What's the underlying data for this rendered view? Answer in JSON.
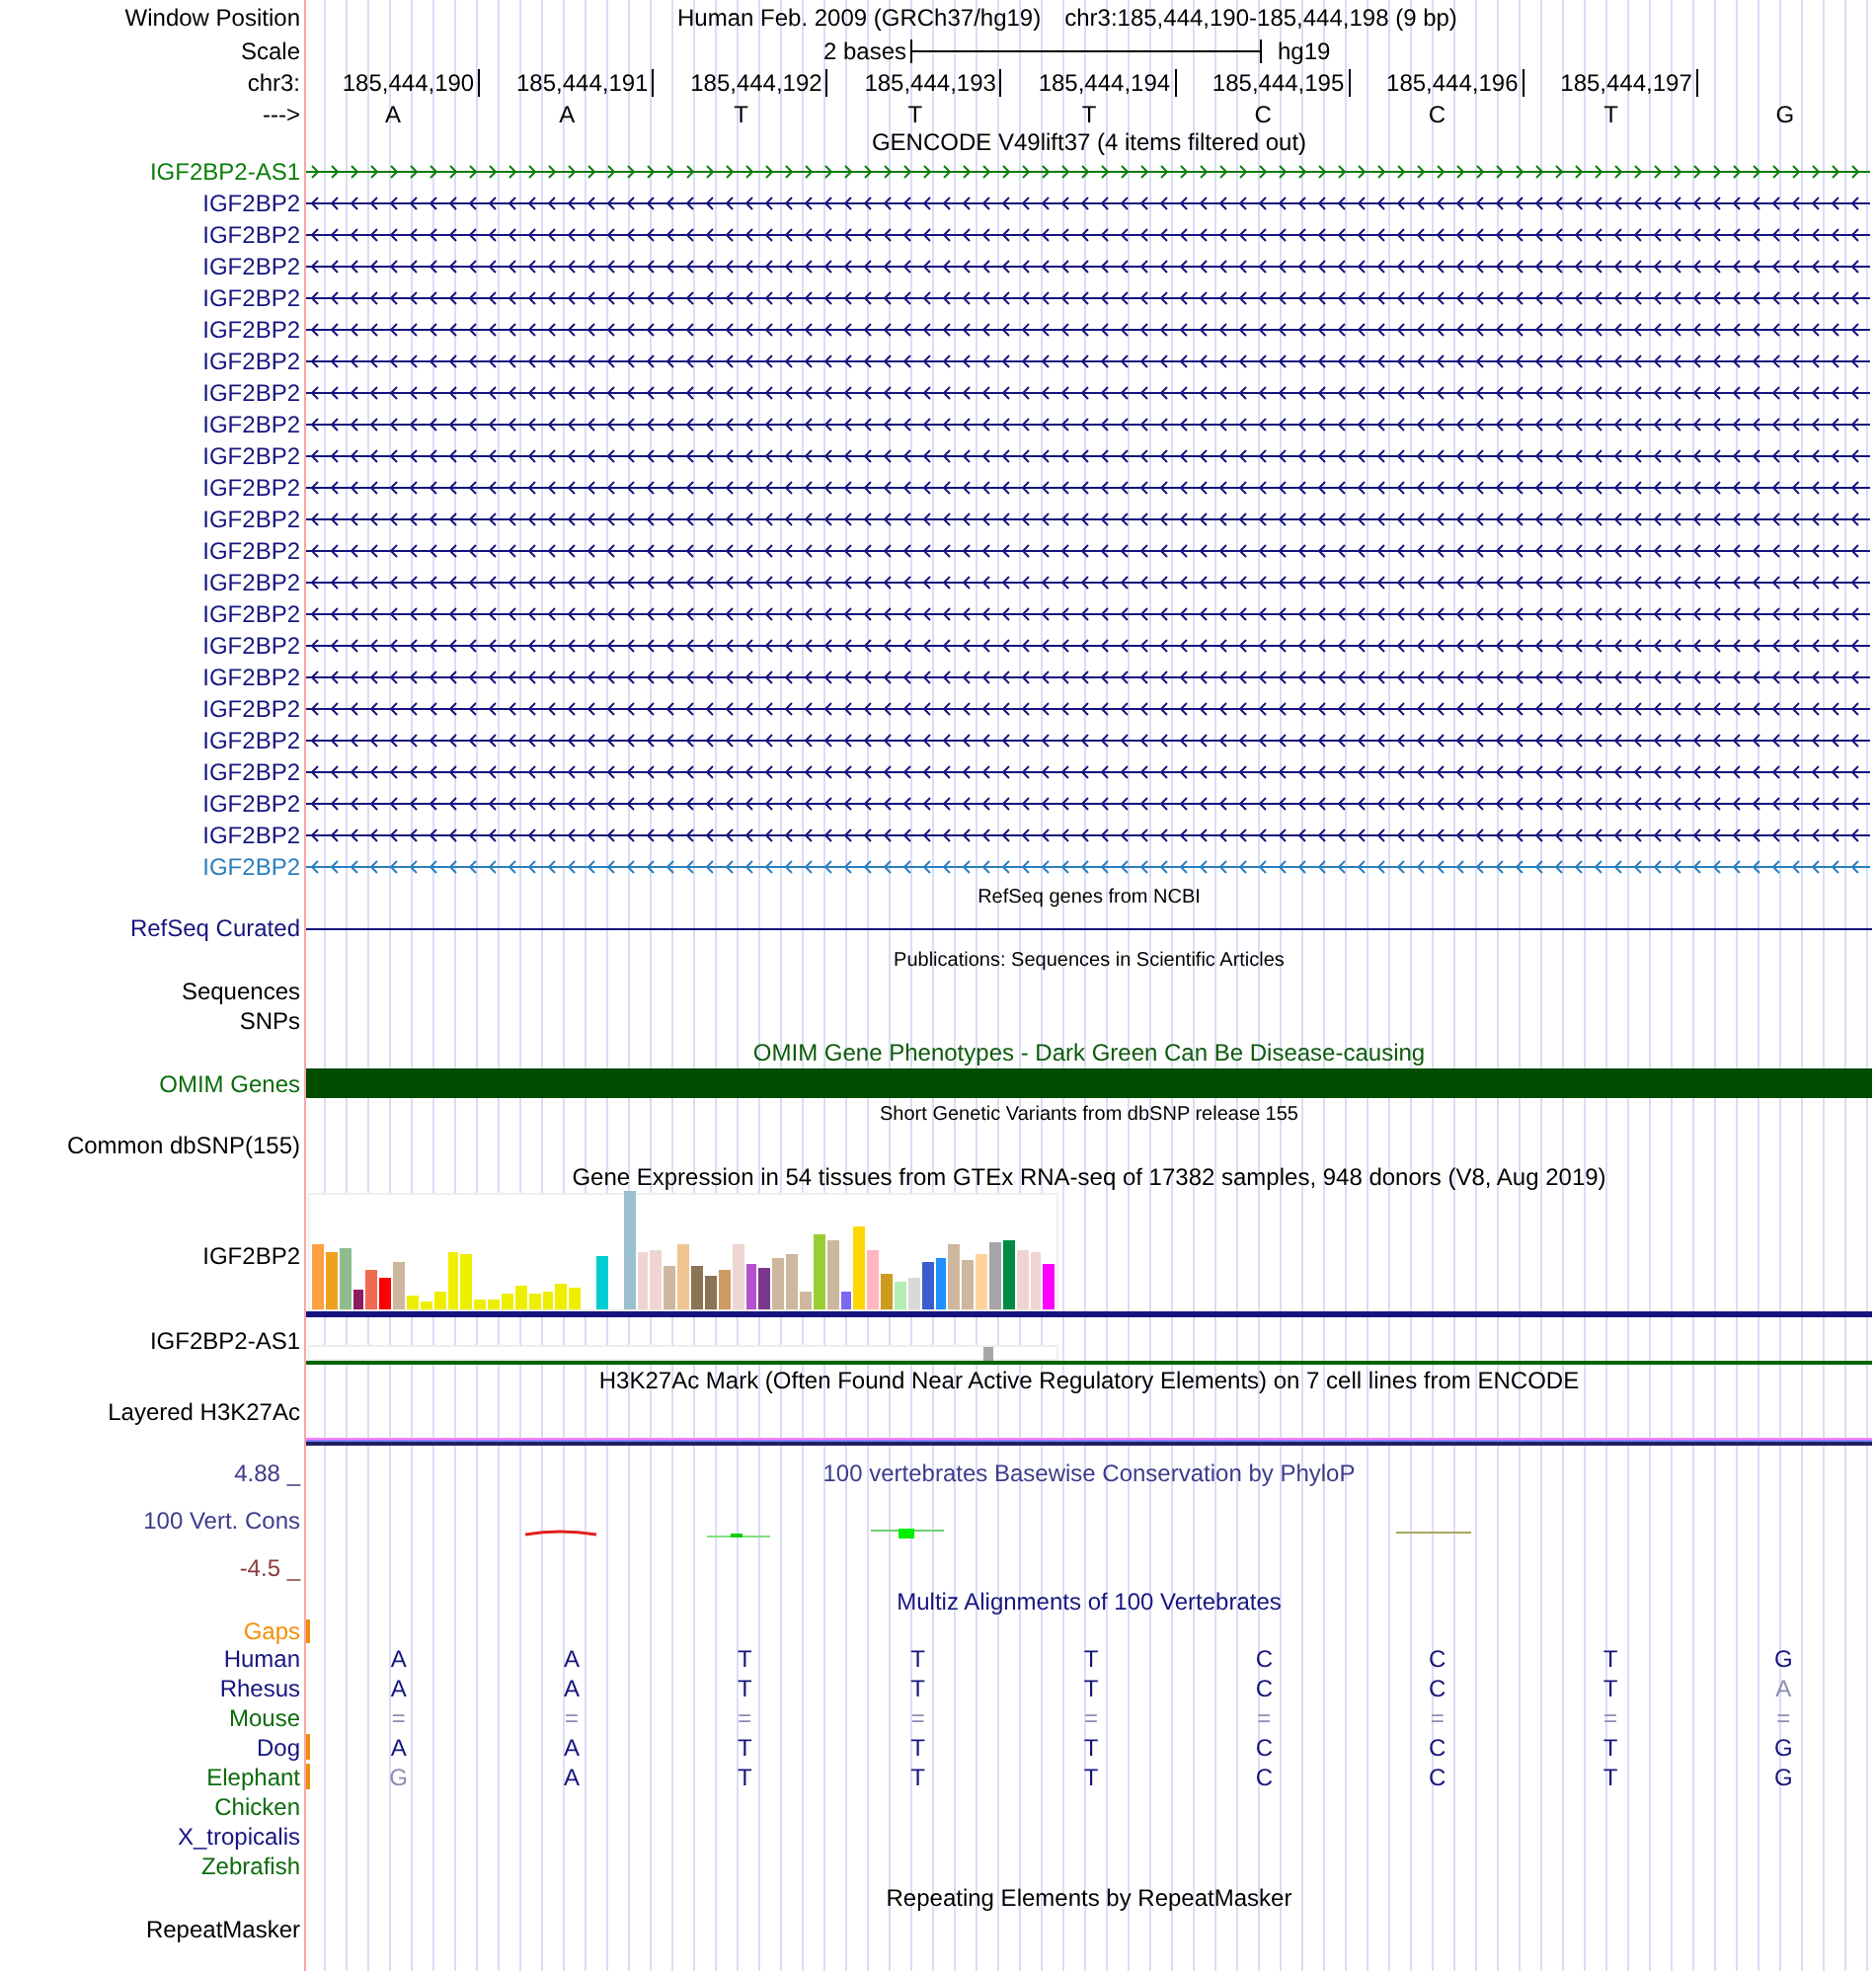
{
  "header": {
    "window_position_label": "Window Position",
    "assembly_title": "Human Feb. 2009 (GRCh37/hg19)",
    "position": "chr3:185,444,190-185,444,198 (9 bp)",
    "scale_label": "Scale",
    "scale_text": "2 bases",
    "scale_assembly": "hg19",
    "chrom_label": "chr3:",
    "positions": [
      "185,444,190",
      "185,444,191",
      "185,444,192",
      "185,444,193",
      "185,444,194",
      "185,444,195",
      "185,444,196",
      "185,444,197"
    ],
    "strand_label": "--->",
    "bases": [
      "A",
      "A",
      "T",
      "T",
      "T",
      "C",
      "C",
      "T",
      "G"
    ]
  },
  "gencode": {
    "title": "GENCODE V49lift37 (4 items filtered out)",
    "genes": [
      {
        "name": "IGF2BP2-AS1",
        "color": "#0b7d0b",
        "kind": "forward"
      },
      {
        "name": "IGF2BP2",
        "color": "#15157f",
        "kind": "reverse"
      },
      {
        "name": "IGF2BP2",
        "color": "#15157f",
        "kind": "reverse"
      },
      {
        "name": "IGF2BP2",
        "color": "#15157f",
        "kind": "reverse"
      },
      {
        "name": "IGF2BP2",
        "color": "#15157f",
        "kind": "reverse"
      },
      {
        "name": "IGF2BP2",
        "color": "#15157f",
        "kind": "reverse"
      },
      {
        "name": "IGF2BP2",
        "color": "#15157f",
        "kind": "reverse"
      },
      {
        "name": "IGF2BP2",
        "color": "#15157f",
        "kind": "reverse"
      },
      {
        "name": "IGF2BP2",
        "color": "#15157f",
        "kind": "reverse"
      },
      {
        "name": "IGF2BP2",
        "color": "#15157f",
        "kind": "reverse"
      },
      {
        "name": "IGF2BP2",
        "color": "#15157f",
        "kind": "reverse"
      },
      {
        "name": "IGF2BP2",
        "color": "#15157f",
        "kind": "reverse"
      },
      {
        "name": "IGF2BP2",
        "color": "#15157f",
        "kind": "reverse"
      },
      {
        "name": "IGF2BP2",
        "color": "#15157f",
        "kind": "reverse"
      },
      {
        "name": "IGF2BP2",
        "color": "#15157f",
        "kind": "reverse"
      },
      {
        "name": "IGF2BP2",
        "color": "#15157f",
        "kind": "reverse"
      },
      {
        "name": "IGF2BP2",
        "color": "#15157f",
        "kind": "reverse"
      },
      {
        "name": "IGF2BP2",
        "color": "#15157f",
        "kind": "reverse"
      },
      {
        "name": "IGF2BP2",
        "color": "#15157f",
        "kind": "reverse"
      },
      {
        "name": "IGF2BP2",
        "color": "#15157f",
        "kind": "reverse"
      },
      {
        "name": "IGF2BP2",
        "color": "#15157f",
        "kind": "reverse"
      },
      {
        "name": "IGF2BP2",
        "color": "#15157f",
        "kind": "reverse"
      },
      {
        "name": "IGF2BP2",
        "color": "#2a7fbf",
        "kind": "reverse"
      }
    ]
  },
  "refseq": {
    "title": "RefSeq genes from NCBI",
    "label": "RefSeq Curated"
  },
  "publications": {
    "title": "Publications: Sequences in Scientific Articles",
    "labels": [
      "Sequences",
      "SNPs"
    ]
  },
  "omim": {
    "title": "OMIM Gene Phenotypes - Dark Green Can Be Disease-causing",
    "label": "OMIM Genes"
  },
  "dbsnp": {
    "title": "Short Genetic Variants from dbSNP release 155",
    "label": "Common dbSNP(155)"
  },
  "gtex": {
    "title": "Gene Expression in 54 tissues from GTEx RNA-seq of 17382 samples, 948 donors (V8, Aug 2019)",
    "genes": [
      "IGF2BP2",
      "IGF2BP2-AS1"
    ]
  },
  "h3k27ac": {
    "title": "H3K27Ac Mark (Often Found Near Active Regulatory Elements) on 7 cell lines from ENCODE",
    "label": "Layered H3K27Ac"
  },
  "phylop": {
    "title": "100 vertebrates Basewise Conservation by PhyloP",
    "label": "100 Vert. Cons",
    "max": "4.88 _",
    "min": "-4.5 _"
  },
  "multiz": {
    "title": "Multiz Alignments of 100 Vertebrates",
    "gaps_label": "Gaps",
    "species": [
      {
        "name": "Human",
        "color": "#15157f",
        "gap_mark": false,
        "bases": [
          {
            "b": "A",
            "dim": false
          },
          {
            "b": "A",
            "dim": false
          },
          {
            "b": "T",
            "dim": false
          },
          {
            "b": "T",
            "dim": false
          },
          {
            "b": "T",
            "dim": false
          },
          {
            "b": "C",
            "dim": false
          },
          {
            "b": "C",
            "dim": false
          },
          {
            "b": "T",
            "dim": false
          },
          {
            "b": "G",
            "dim": false
          }
        ]
      },
      {
        "name": "Rhesus",
        "color": "#15157f",
        "gap_mark": false,
        "bases": [
          {
            "b": "A",
            "dim": false
          },
          {
            "b": "A",
            "dim": false
          },
          {
            "b": "T",
            "dim": false
          },
          {
            "b": "T",
            "dim": false
          },
          {
            "b": "T",
            "dim": false
          },
          {
            "b": "C",
            "dim": false
          },
          {
            "b": "C",
            "dim": false
          },
          {
            "b": "T",
            "dim": false
          },
          {
            "b": "A",
            "dim": true
          }
        ]
      },
      {
        "name": "Mouse",
        "color": "#0b6b0b",
        "gap_mark": false,
        "bases": [
          {
            "b": "=",
            "dim": true
          },
          {
            "b": "=",
            "dim": true
          },
          {
            "b": "=",
            "dim": true
          },
          {
            "b": "=",
            "dim": true
          },
          {
            "b": "=",
            "dim": true
          },
          {
            "b": "=",
            "dim": true
          },
          {
            "b": "=",
            "dim": true
          },
          {
            "b": "=",
            "dim": true
          },
          {
            "b": "=",
            "dim": true
          }
        ]
      },
      {
        "name": "Dog",
        "color": "#15157f",
        "gap_mark": true,
        "bases": [
          {
            "b": "A",
            "dim": false
          },
          {
            "b": "A",
            "dim": false
          },
          {
            "b": "T",
            "dim": false
          },
          {
            "b": "T",
            "dim": false
          },
          {
            "b": "T",
            "dim": false
          },
          {
            "b": "C",
            "dim": false
          },
          {
            "b": "C",
            "dim": false
          },
          {
            "b": "T",
            "dim": false
          },
          {
            "b": "G",
            "dim": false
          }
        ]
      },
      {
        "name": "Elephant",
        "color": "#0b6b0b",
        "gap_mark": true,
        "bases": [
          {
            "b": "G",
            "dim": true
          },
          {
            "b": "A",
            "dim": false
          },
          {
            "b": "T",
            "dim": false
          },
          {
            "b": "T",
            "dim": false
          },
          {
            "b": "T",
            "dim": false
          },
          {
            "b": "C",
            "dim": false
          },
          {
            "b": "C",
            "dim": false
          },
          {
            "b": "T",
            "dim": false
          },
          {
            "b": "G",
            "dim": false
          }
        ]
      },
      {
        "name": "Chicken",
        "color": "#0b6b0b",
        "gap_mark": false
      },
      {
        "name": "X_tropicalis",
        "color": "#15157f",
        "gap_mark": false
      },
      {
        "name": "Zebrafish",
        "color": "#0b6b0b",
        "gap_mark": false
      }
    ]
  },
  "repeatmasker": {
    "title": "Repeating Elements by RepeatMasker",
    "label": "RepeatMasker"
  }
}
